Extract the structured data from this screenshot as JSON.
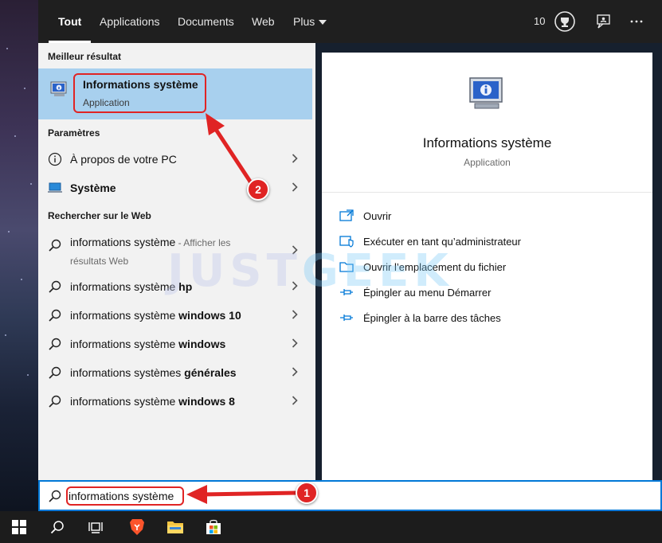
{
  "tabs": [
    {
      "label": "Tout",
      "active": true
    },
    {
      "label": "Applications"
    },
    {
      "label": "Documents"
    },
    {
      "label": "Web"
    },
    {
      "label": "Plus"
    }
  ],
  "top_right": {
    "points": "10",
    "trophy_icon": "trophy-icon",
    "feedback_icon": "feedback-icon",
    "more_icon": "more-icon"
  },
  "best": {
    "heading": "Meilleur résultat",
    "title": "Informations système",
    "subtitle": "Application"
  },
  "settings": {
    "heading": "Paramètres",
    "items": [
      {
        "label": "À propos de votre PC",
        "icon": "info-icon"
      },
      {
        "label": "Système",
        "icon": "laptop-icon"
      }
    ]
  },
  "web": {
    "heading": "Rechercher sur le Web",
    "first": {
      "base": "informations système",
      "suffix": " - Afficher les résultats Web"
    },
    "items": [
      {
        "base": "informations système ",
        "bold": "hp"
      },
      {
        "base": "informations système ",
        "bold": "windows 10"
      },
      {
        "base": "informations système ",
        "bold": "windows"
      },
      {
        "base": "informations systèmes ",
        "bold": "générales"
      },
      {
        "base": "informations système ",
        "bold": "windows 8"
      }
    ]
  },
  "preview": {
    "title": "Informations système",
    "subtitle": "Application",
    "actions": [
      {
        "label": "Ouvrir",
        "icon": "open-icon"
      },
      {
        "label": "Exécuter en tant qu’administrateur",
        "icon": "shield-icon"
      },
      {
        "label": "Ouvrir l’emplacement du fichier",
        "icon": "folder-icon"
      },
      {
        "label": "Épingler au menu Démarrer",
        "icon": "pin-icon"
      },
      {
        "label": "Épingler à la barre des tâches",
        "icon": "pin-icon"
      }
    ]
  },
  "search": {
    "value": "informations système"
  },
  "watermark": {
    "part1": "JUST",
    "part2": "GEEK"
  },
  "annotations": {
    "badge1": "1",
    "badge2": "2",
    "color": "#e02424"
  },
  "colors": {
    "accent": "#0078d7",
    "selected": "#a8d0ee",
    "topbar": "#1f1f1f"
  }
}
